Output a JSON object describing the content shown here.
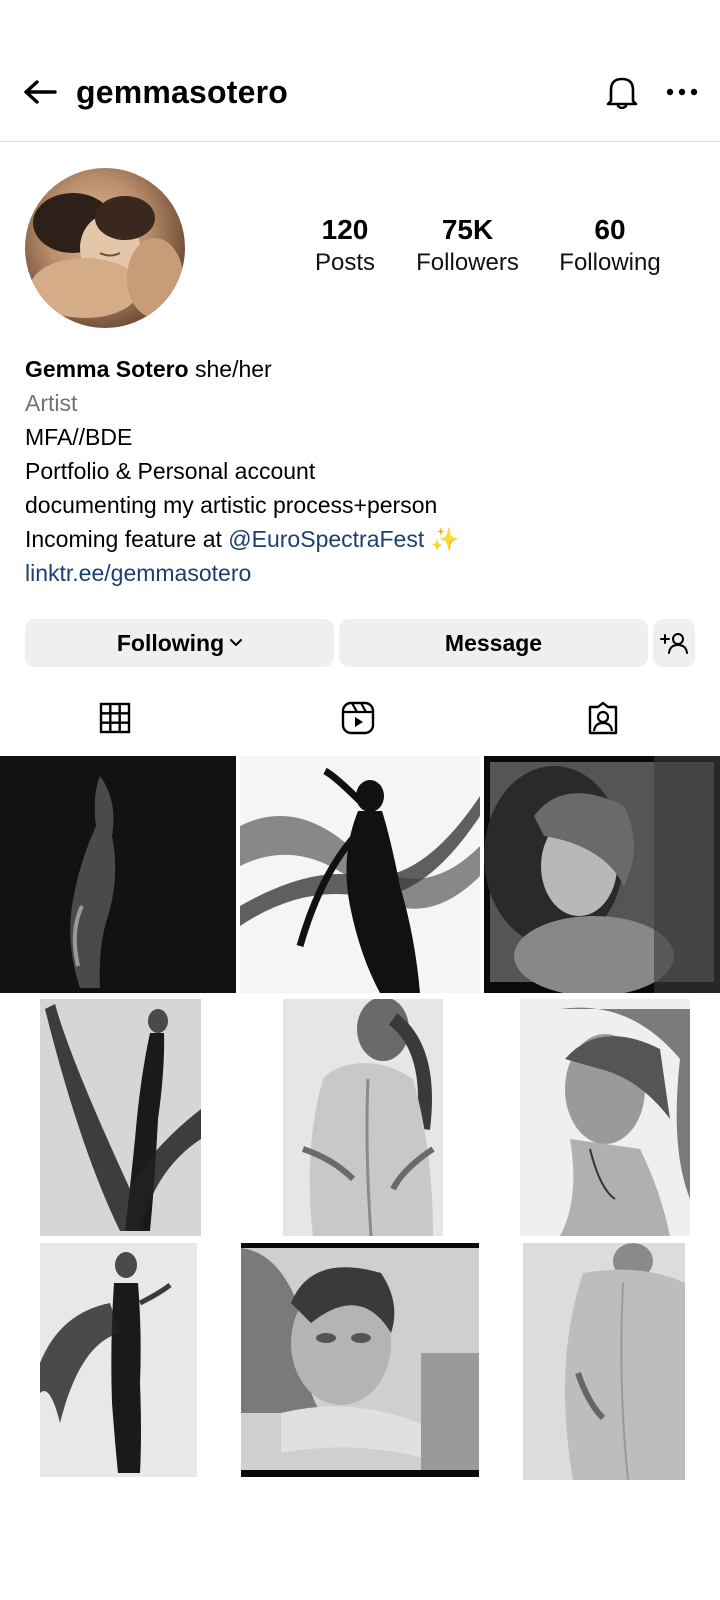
{
  "header": {
    "username": "gemmasotero",
    "icons": [
      "back-arrow-icon",
      "bell-icon",
      "more-options-icon"
    ]
  },
  "stats": {
    "posts": {
      "value": "120",
      "label": "Posts"
    },
    "followers": {
      "value": "75K",
      "label": "Followers"
    },
    "following": {
      "value": "60",
      "label": "Following"
    }
  },
  "bio": {
    "name": "Gemma Sotero",
    "pronouns": "she/her",
    "category": "Artist",
    "line1": "MFA//BDE",
    "line2": "Portfolio & Personal account",
    "line3": "documenting my artistic process+person",
    "line4_prefix": "Incoming feature at",
    "mention": "@EuroSpectraFest",
    "sparkles": "✨",
    "link": "linktr.ee/gemmasotero"
  },
  "actions": {
    "following_label": "Following",
    "message_label": "Message",
    "add_person_icon": "add-person-icon"
  },
  "tabs": [
    "grid-icon",
    "reels-icon",
    "tagged-icon"
  ],
  "grid": {
    "count": 9
  },
  "colors": {
    "link": "#1b3f73",
    "button_bg": "#efefef",
    "secondary_text": "#737373",
    "sparkle": "#f5d76e"
  }
}
